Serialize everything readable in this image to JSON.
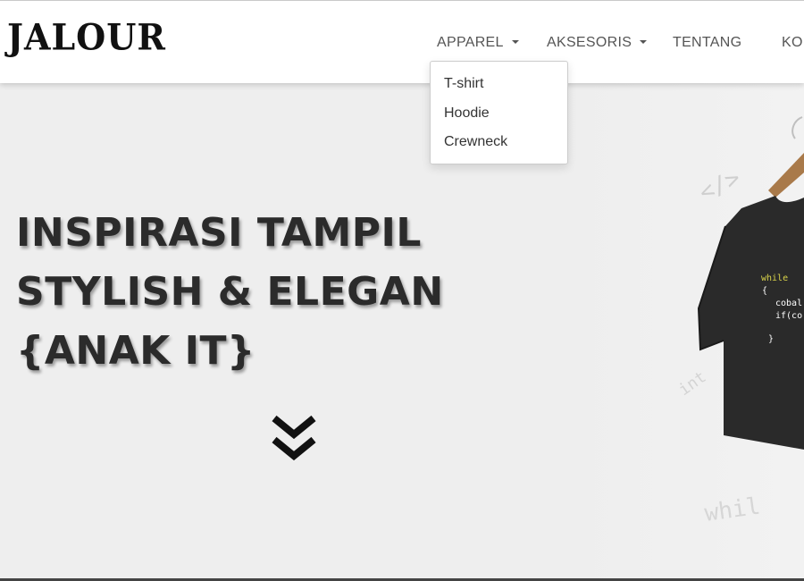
{
  "brand": {
    "logo_text": "JALOUR"
  },
  "nav": {
    "items": [
      {
        "label": "APPAREL",
        "has_dropdown": true
      },
      {
        "label": "AKSESORIS",
        "has_dropdown": true
      },
      {
        "label": "TENTANG",
        "has_dropdown": false
      },
      {
        "label": "KO",
        "has_dropdown": false
      }
    ]
  },
  "dropdown": {
    "items": [
      {
        "label": "T-shirt"
      },
      {
        "label": "Hoodie"
      },
      {
        "label": "Crewneck"
      }
    ]
  },
  "hero": {
    "lines": [
      "INSPIRASI TAMPIL",
      "STYLISH & ELEGAN",
      "{ANAK IT}"
    ],
    "scroll_icon": "double-chevron-down-icon"
  },
  "shirt_print": {
    "code_lines": [
      "while",
      "{",
      "cobal",
      "if(co",
      "}"
    ],
    "bg_marks": [
      "</>",
      "int",
      "whil"
    ]
  },
  "colors": {
    "navbar_bg": "#ffffff",
    "hero_bg": "#eeeeee",
    "headline": "#2b2b2b",
    "code_text": "#d8d24a"
  }
}
